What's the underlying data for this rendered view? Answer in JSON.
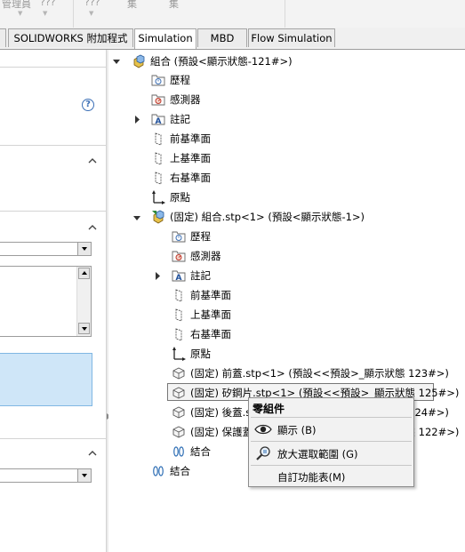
{
  "toolbar": {
    "labels": [
      "管理員",
      "???",
      "???",
      "集",
      "集"
    ]
  },
  "tabs": [
    {
      "label": "SOLIDWORKS 附加程式",
      "active": false
    },
    {
      "label": "Simulation",
      "active": true
    },
    {
      "label": "MBD",
      "active": false
    },
    {
      "label": "Flow Simulation",
      "active": false
    }
  ],
  "left_panel": {
    "help_glyph": "?"
  },
  "tree": {
    "root": "組合 (預設<顯示狀態-121#>)",
    "root_items": {
      "history": "歷程",
      "sensors": "感測器",
      "annotations": "註記",
      "front_plane": "前基準面",
      "top_plane": "上基準面",
      "right_plane": "右基準面",
      "origin": "原點"
    },
    "subassembly": "(固定) 組合.stp<1> (預設<顯示狀態-1>)",
    "sub_items": {
      "history": "歷程",
      "sensors": "感測器",
      "annotations": "註記",
      "front_plane": "前基準面",
      "top_plane": "上基準面",
      "right_plane": "右基準面",
      "origin": "原點"
    },
    "parts": [
      "(固定) 前蓋.stp<1> (預設<<預設>_顯示狀態 123#>)",
      "(固定) 矽鋼片.stp<1> (預設<<預設>_顯示狀態 125#>)",
      "(固定) 後蓋.stp<1> (預設<<預設>_顯示狀態 124#>)",
      "(固定) 保護蓋.stp<1> (預設<<預設>_顯示狀態 122#>)"
    ],
    "sub_mates": "結合",
    "root_mates": "結合"
  },
  "context_menu": {
    "header": "零組件",
    "items": [
      {
        "label": "顯示 (B)",
        "icon": "eye-icon"
      },
      {
        "label": "放大選取範圍 (G)",
        "icon": "zoom-to-selection-icon"
      },
      {
        "label": "自訂功能表(M)",
        "icon": ""
      }
    ]
  }
}
